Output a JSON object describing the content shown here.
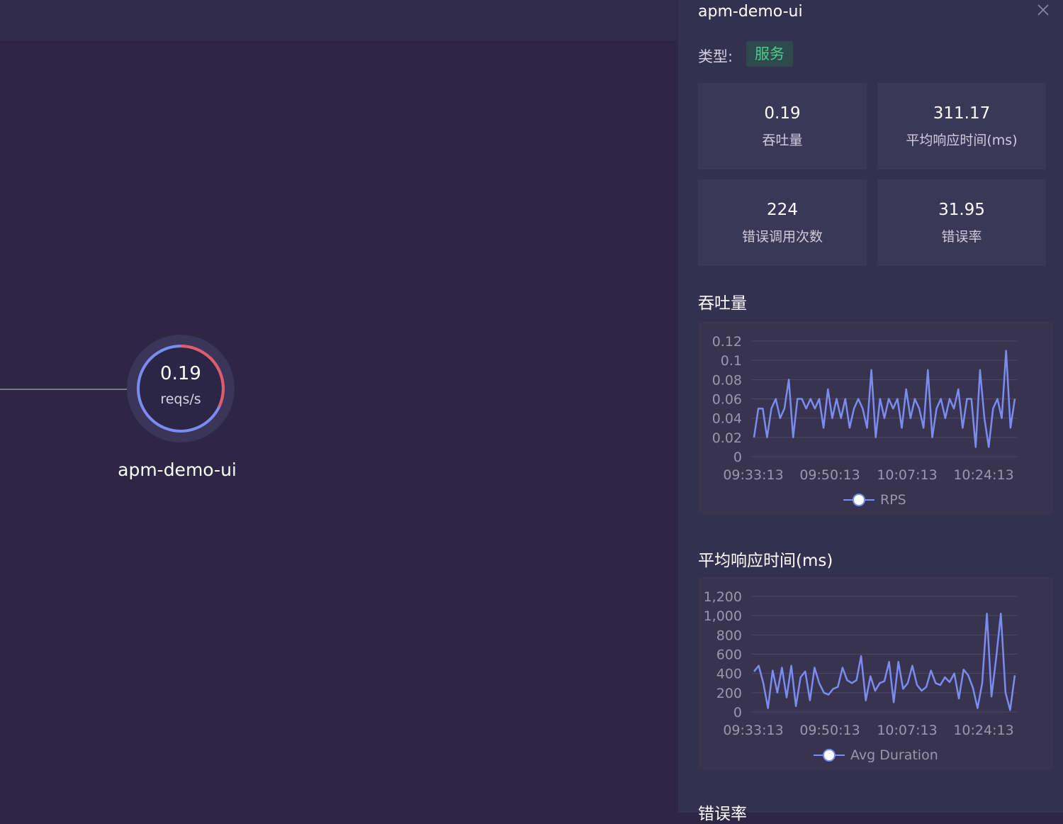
{
  "node": {
    "value": "0.19",
    "unit": "reqs/s",
    "name": "apm-demo-ui",
    "error_fraction": 0.32
  },
  "panel": {
    "title": "apm-demo-ui",
    "type_label": "类型:",
    "type_tag": "服务",
    "stats": [
      {
        "value": "0.19",
        "label": "吞吐量"
      },
      {
        "value": "311.17",
        "label": "平均响应时间(ms)"
      },
      {
        "value": "224",
        "label": "错误调用次数"
      },
      {
        "value": "31.95",
        "label": "错误率"
      }
    ],
    "sections": {
      "throughput": "吞吐量",
      "duration": "平均响应时间(ms)",
      "error_rate": "错误率"
    }
  },
  "colors": {
    "series_line": "#7b8cf0",
    "node_ring_blue": "#7b8cf0",
    "node_ring_red": "#e35b6a",
    "tag_text": "#4ccb8b"
  },
  "chart_data": [
    {
      "type": "line",
      "x_ticks": [
        "09:33:13",
        "09:50:13",
        "10:07:13",
        "10:24:13"
      ],
      "y_ticks": [
        "0.12",
        "0.1",
        "0.08",
        "0.06",
        "0.04",
        "0.02",
        "0"
      ],
      "ylim": [
        0,
        0.12
      ],
      "series": [
        {
          "name": "RPS",
          "values": [
            0.02,
            0.05,
            0.05,
            0.02,
            0.05,
            0.06,
            0.04,
            0.05,
            0.08,
            0.02,
            0.06,
            0.06,
            0.05,
            0.06,
            0.05,
            0.06,
            0.03,
            0.07,
            0.04,
            0.06,
            0.04,
            0.06,
            0.03,
            0.05,
            0.06,
            0.05,
            0.03,
            0.09,
            0.02,
            0.06,
            0.04,
            0.06,
            0.05,
            0.06,
            0.03,
            0.07,
            0.04,
            0.06,
            0.05,
            0.03,
            0.09,
            0.02,
            0.05,
            0.06,
            0.04,
            0.06,
            0.05,
            0.07,
            0.03,
            0.06,
            0.06,
            0.01,
            0.09,
            0.04,
            0.01,
            0.05,
            0.06,
            0.04,
            0.11,
            0.03,
            0.06
          ]
        }
      ],
      "legend": "bottom-center",
      "grid": true
    },
    {
      "type": "line",
      "x_ticks": [
        "09:33:13",
        "09:50:13",
        "10:07:13",
        "10:24:13"
      ],
      "y_ticks": [
        "1,200",
        "1,000",
        "800",
        "600",
        "400",
        "200",
        "0"
      ],
      "ylim": [
        0,
        1200
      ],
      "series": [
        {
          "name": "Avg Duration",
          "values": [
            420,
            480,
            300,
            40,
            430,
            200,
            460,
            150,
            480,
            60,
            360,
            420,
            120,
            460,
            300,
            200,
            180,
            240,
            260,
            460,
            330,
            300,
            330,
            580,
            120,
            370,
            220,
            300,
            320,
            520,
            100,
            520,
            240,
            300,
            480,
            280,
            220,
            260,
            430,
            300,
            280,
            360,
            310,
            400,
            140,
            440,
            380,
            250,
            40,
            300,
            1020,
            160,
            560,
            1020,
            200,
            20,
            380
          ]
        }
      ],
      "legend": "bottom-center",
      "grid": true
    }
  ]
}
